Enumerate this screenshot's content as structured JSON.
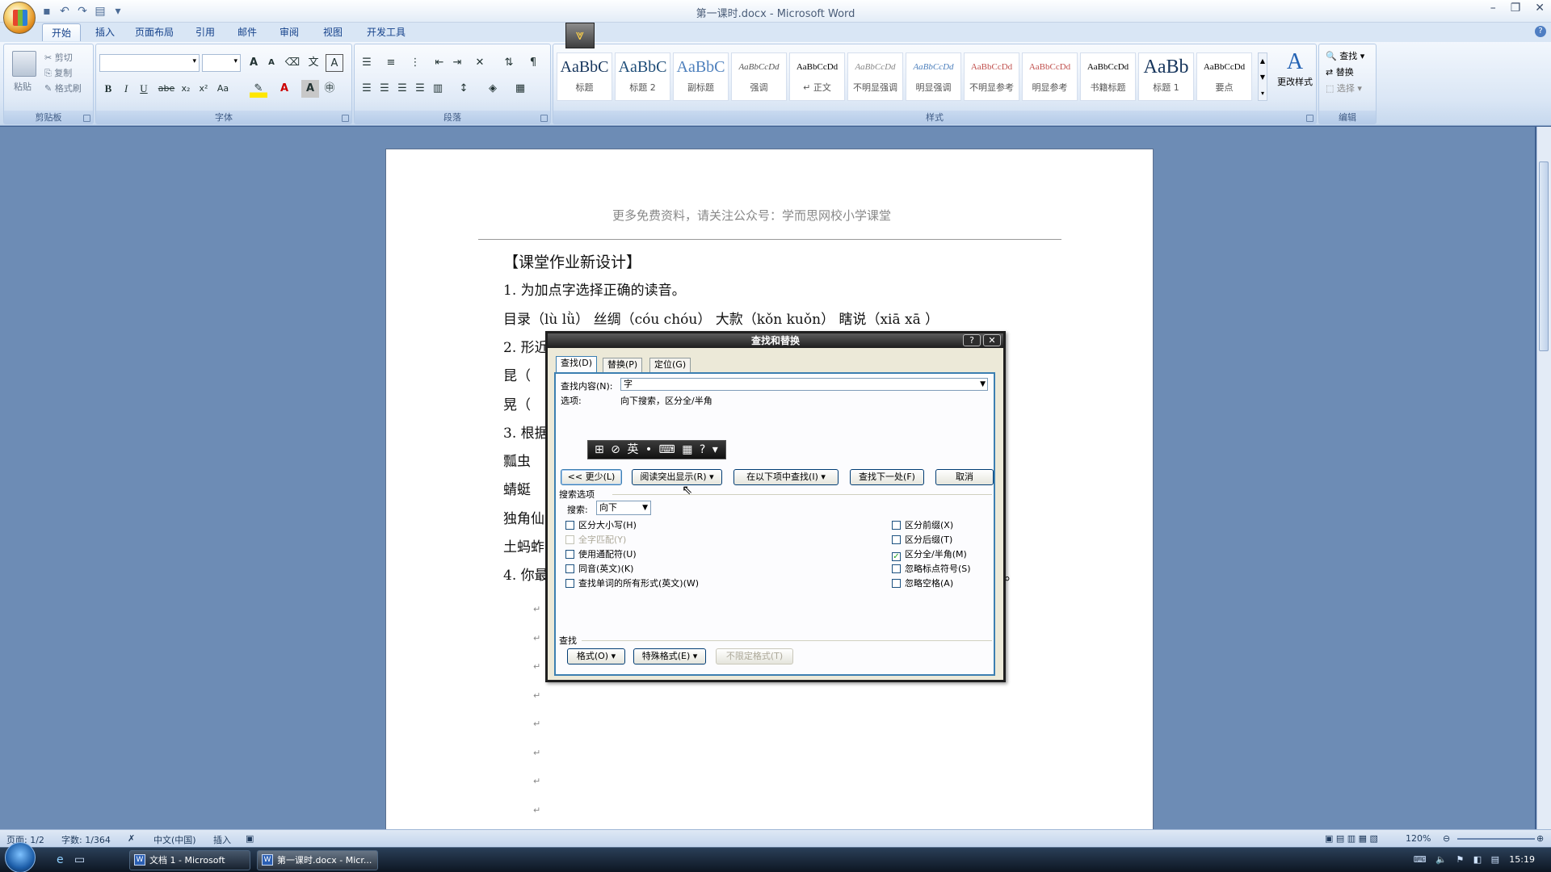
{
  "window": {
    "title": "第一课时.docx - Microsoft Word",
    "controls": [
      "–",
      "❐",
      "✕"
    ]
  },
  "ribbon_tabs": [
    "开始",
    "插入",
    "页面布局",
    "引用",
    "邮件",
    "审阅",
    "视图",
    "开发工具"
  ],
  "clipboard": {
    "paste": "粘贴",
    "cut": "剪切",
    "copy": "复制",
    "format_painter": "格式刷",
    "label": "剪贴板"
  },
  "font_group": {
    "label": "字体",
    "bold": "B",
    "italic": "I",
    "underline": "U",
    "strike": "abe",
    "sub": "x₂",
    "sup": "x²",
    "case": "Aa",
    "grow": "A",
    "shrink": "A"
  },
  "paragraph_group": {
    "label": "段落"
  },
  "styles_group": {
    "label": "样式",
    "styles": [
      {
        "preview": "AaBbC",
        "name": "标题"
      },
      {
        "preview": "AaBbC",
        "name": "标题 2"
      },
      {
        "preview": "AaBbC",
        "name": "副标题"
      },
      {
        "preview": "AaBbCcDd",
        "name": "强调"
      },
      {
        "preview": "AaBbCcDd",
        "name": "↵ 正文"
      },
      {
        "preview": "AaBbCcDd",
        "name": "不明显强调"
      },
      {
        "preview": "AaBbCcDd",
        "name": "明显强调"
      },
      {
        "preview": "AaBbCcDd",
        "name": "不明显参考"
      },
      {
        "preview": "AaBbCcDd",
        "name": "明显参考"
      },
      {
        "preview": "AaBbCcDd",
        "name": "书籍标题"
      },
      {
        "preview": "AaBb",
        "name": "标题 1"
      },
      {
        "preview": "AaBbCcDd",
        "name": "要点"
      }
    ],
    "change_styles": "更改样式"
  },
  "editing_group": {
    "label": "编辑",
    "find": "查找",
    "replace": "替换",
    "select": "选择"
  },
  "document": {
    "header": "更多免费资料，请关注公众号：学而思网校小学课堂",
    "lines": [
      "【课堂作业新设计】",
      "1. 为加点字选择正确的读音。",
      "目录（lù lǜ） 丝绸（cóu  chóu） 大款（kǒn kuǒn） 瞎说（xiā xā ）",
      "2. 形近",
      "昆（",
      "晃（",
      "3. 根据",
      "瓢虫",
      "蜻蜓",
      "独角仙",
      "土蚂蚱",
      "4. 你最"
    ],
    "line4_tail": "）。"
  },
  "dialog": {
    "title": "查找和替换",
    "tabs": [
      "查找(D)",
      "替换(P)",
      "定位(G)"
    ],
    "find_label": "查找内容(N):",
    "find_value": "字",
    "options_label": "选项:",
    "options_value": "向下搜索，区分全/半角",
    "ime_text": "英",
    "buttons": {
      "less": "<< 更少(L)",
      "reading_highlight": "阅读突出显示(R) ▾",
      "find_in": "在以下项中查找(I) ▾",
      "find_next": "查找下一处(F)",
      "cancel": "取消"
    },
    "search_options_label": "搜索选项",
    "search_label": "搜索:",
    "search_value": "向下",
    "left_checks": [
      {
        "label": "区分大小写(H)",
        "checked": false,
        "disabled": false
      },
      {
        "label": "全字匹配(Y)",
        "checked": false,
        "disabled": true
      },
      {
        "label": "使用通配符(U)",
        "checked": false,
        "disabled": false
      },
      {
        "label": "同音(英文)(K)",
        "checked": false,
        "disabled": false
      },
      {
        "label": "查找单词的所有形式(英文)(W)",
        "checked": false,
        "disabled": false
      }
    ],
    "right_checks": [
      {
        "label": "区分前缀(X)",
        "checked": false
      },
      {
        "label": "区分后缀(T)",
        "checked": false
      },
      {
        "label": "区分全/半角(M)",
        "checked": true
      },
      {
        "label": "忽略标点符号(S)",
        "checked": false
      },
      {
        "label": "忽略空格(A)",
        "checked": false
      }
    ],
    "find_section_label": "查找",
    "format_btn": "格式(O) ▾",
    "special_btn": "特殊格式(E) ▾",
    "no_format_btn": "不限定格式(T)"
  },
  "status_bar": {
    "page": "页面: 1/2",
    "words": "字数: 1/364",
    "language": "中文(中国)",
    "mode": "插入",
    "zoom": "120%"
  },
  "taskbar": {
    "tasks": [
      "文档 1 - Microsoft Word",
      "第一课时.docx - Micr..."
    ],
    "clock": "15:19"
  }
}
